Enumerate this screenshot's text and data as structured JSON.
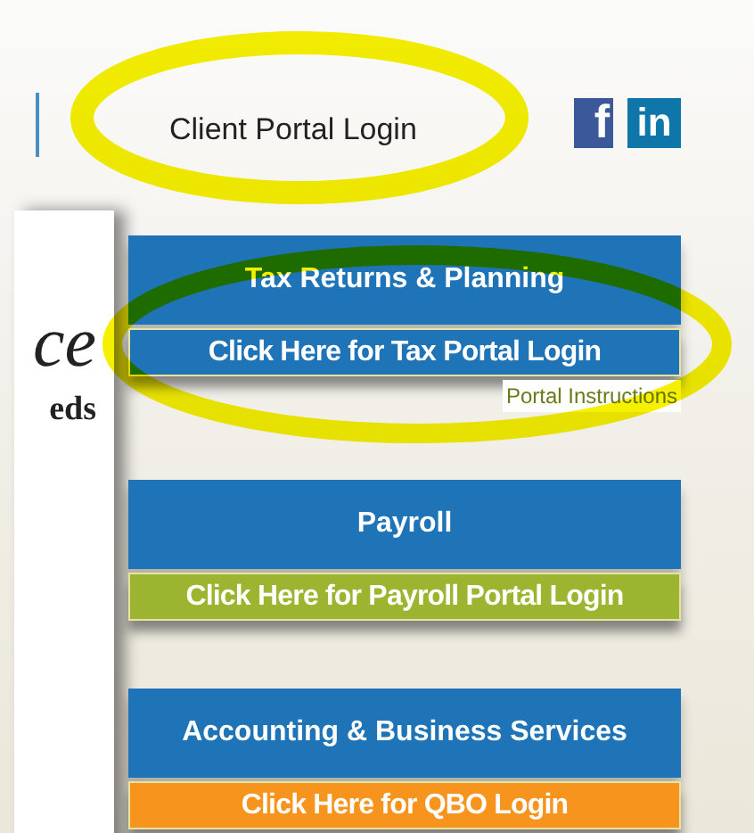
{
  "header": {
    "link": "Client Portal Login"
  },
  "social": [
    {
      "kind": "facebook",
      "label": "f"
    },
    {
      "kind": "linkedin",
      "label": "in"
    }
  ],
  "intro": {
    "heading_fragment": "ce",
    "text_fragment": "eds"
  },
  "services": [
    {
      "title": "Tax Returns & Planning",
      "button": "Click Here for Tax Portal Login",
      "color": "#1f73b7",
      "note": "Portal Instructions"
    },
    {
      "title": "Payroll",
      "button": "Click Here for Payroll Portal Login",
      "color": "#9cb530"
    },
    {
      "title": "Accounting & Business Services",
      "button": "Click Here for QBO Login",
      "color": "#f7941d"
    }
  ]
}
